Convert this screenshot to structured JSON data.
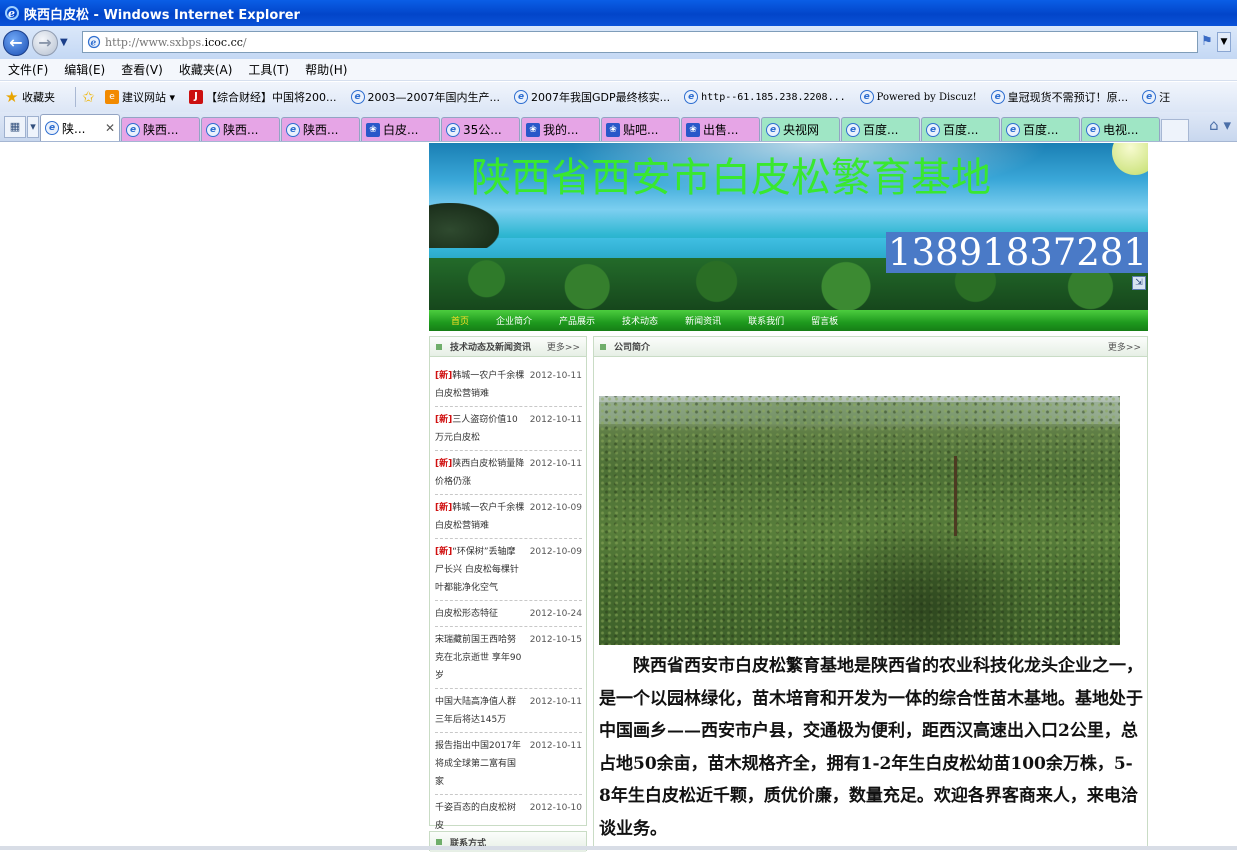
{
  "window": {
    "title": "陕西白皮松 - Windows Internet Explorer"
  },
  "address": {
    "url_prefix": "http://www.sxbps.",
    "url_domain": "icoc.cc",
    "url_suffix": "/"
  },
  "menu": [
    "文件(F)",
    "编辑(E)",
    "查看(V)",
    "收藏夹(A)",
    "工具(T)",
    "帮助(H)"
  ],
  "favorites": {
    "main_label": "收藏夹",
    "items": [
      {
        "icon": "orange",
        "label": "建议网站 ▾"
      },
      {
        "icon": "red",
        "label": "【综合财经】中国将200..."
      },
      {
        "icon": "ie",
        "label": "2003—2007年国内生产..."
      },
      {
        "icon": "ie",
        "label": "2007年我国GDP最终核实..."
      },
      {
        "icon": "ie",
        "label": "http--61.185.238.2208..."
      },
      {
        "icon": "ie",
        "label": "Powered by Discuz!"
      },
      {
        "icon": "ie",
        "label": "皇冠现货不需预订！原..."
      },
      {
        "icon": "ie",
        "label": "汪"
      }
    ]
  },
  "tabs": [
    {
      "label": "陕...",
      "style": "active",
      "icon": "ie"
    },
    {
      "label": "陕西...",
      "style": "pink",
      "icon": "ie"
    },
    {
      "label": "陕西...",
      "style": "pink",
      "icon": "ie"
    },
    {
      "label": "陕西...",
      "style": "pink",
      "icon": "ie"
    },
    {
      "label": "白皮...",
      "style": "pink",
      "icon": "paw"
    },
    {
      "label": "35公...",
      "style": "pink",
      "icon": "ie"
    },
    {
      "label": "我的...",
      "style": "pink",
      "icon": "paw"
    },
    {
      "label": "贴吧...",
      "style": "pink",
      "icon": "paw"
    },
    {
      "label": "出售...",
      "style": "pink",
      "icon": "paw"
    },
    {
      "label": "央视网",
      "style": "green",
      "icon": "ie"
    },
    {
      "label": "百度...",
      "style": "green",
      "icon": "ie"
    },
    {
      "label": "百度...",
      "style": "green",
      "icon": "ie"
    },
    {
      "label": "百度...",
      "style": "green",
      "icon": "ie"
    },
    {
      "label": "电视...",
      "style": "green",
      "icon": "ie"
    }
  ],
  "site": {
    "banner_title": "陕西省西安市白皮松繁育基地",
    "phone": "13891837281",
    "nav": [
      "首页",
      "企业简介",
      "产品展示",
      "技术动态",
      "新闻资讯",
      "联系我们",
      "留言板"
    ],
    "nav_current": 0,
    "news_box": {
      "title": "技术动态及新闻资讯",
      "more": "更多>>",
      "tag": "[新]",
      "items": [
        {
          "tagged": true,
          "title": "韩城一农户千余棵白皮松营销难",
          "date": "2012-10-11"
        },
        {
          "tagged": true,
          "title": "三人盗窃价值10万元白皮松",
          "date": "2012-10-11"
        },
        {
          "tagged": true,
          "title": "陕西白皮松销量降价格仍涨",
          "date": "2012-10-11"
        },
        {
          "tagged": true,
          "title": "韩城一农户千余棵白皮松营销难",
          "date": "2012-10-09"
        },
        {
          "tagged": true,
          "title": "“环保树”丢轴摩尸长兴 白皮松每棵针叶都能净化空气",
          "date": "2012-10-09"
        },
        {
          "tagged": false,
          "title": "白皮松形态特征",
          "date": "2012-10-24"
        },
        {
          "tagged": false,
          "title": "宋瑞藏前国王西哈努克在北京逝世 享年90岁",
          "date": "2012-10-15"
        },
        {
          "tagged": false,
          "title": "中国大陆高净值人群三年后将达145万",
          "date": "2012-10-11"
        },
        {
          "tagged": false,
          "title": "报告指出中国2017年将成全球第二富有国家",
          "date": "2012-10-11"
        },
        {
          "tagged": false,
          "title": "千姿百态的白皮松树皮",
          "date": "2012-10-10"
        }
      ]
    },
    "contact_box": {
      "title": "联系方式"
    },
    "intro_box": {
      "title": "公司简介",
      "more": "更多>>",
      "text": "陕西省西安市白皮松繁育基地是陕西省的农业科技化龙头企业之一，是一个以园林绿化，苗木培育和开发为一体的综合性苗木基地。基地处于中国画乡——西安市户县，交通极为便利，距西汉高速出入口2公里，总占地50余亩，苗木规格齐全，拥有1-2年生白皮松幼苗100余万株，5-8年生白皮松近千颗，质优价廉，数量充足。欢迎各界客商来人，来电洽谈业务。"
    }
  }
}
